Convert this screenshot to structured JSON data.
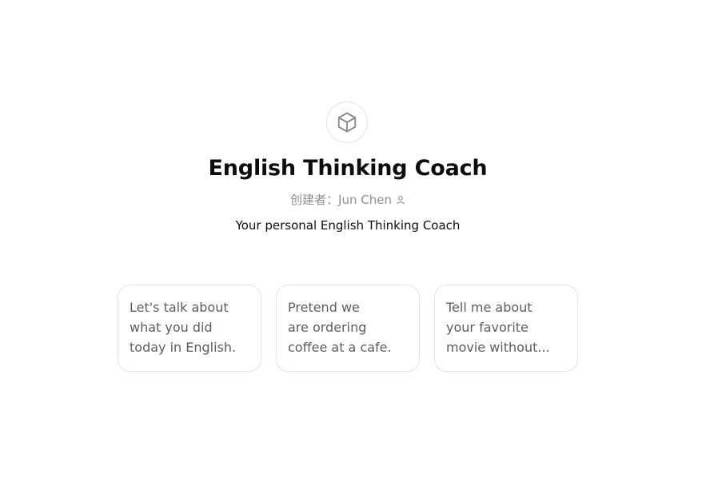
{
  "gizmo": {
    "logo_icon": "cube-icon",
    "title": "English Thinking Coach",
    "creator_prefix": "创建者：",
    "creator_name": "Jun Chen",
    "creator_icon": "person-icon",
    "description": "Your personal English Thinking Coach"
  },
  "starters": [
    {
      "text": "Let's talk about\nwhat you did\ntoday in English."
    },
    {
      "text": "Pretend we\nare ordering\ncoffee at a cafe."
    },
    {
      "text": "Tell me about\nyour favorite\nmovie without..."
    }
  ],
  "colors": {
    "title": "#0d0d0d",
    "muted": "#8f8f8f",
    "card_text": "#5d5d5d",
    "card_border": "#e5e5e5"
  }
}
